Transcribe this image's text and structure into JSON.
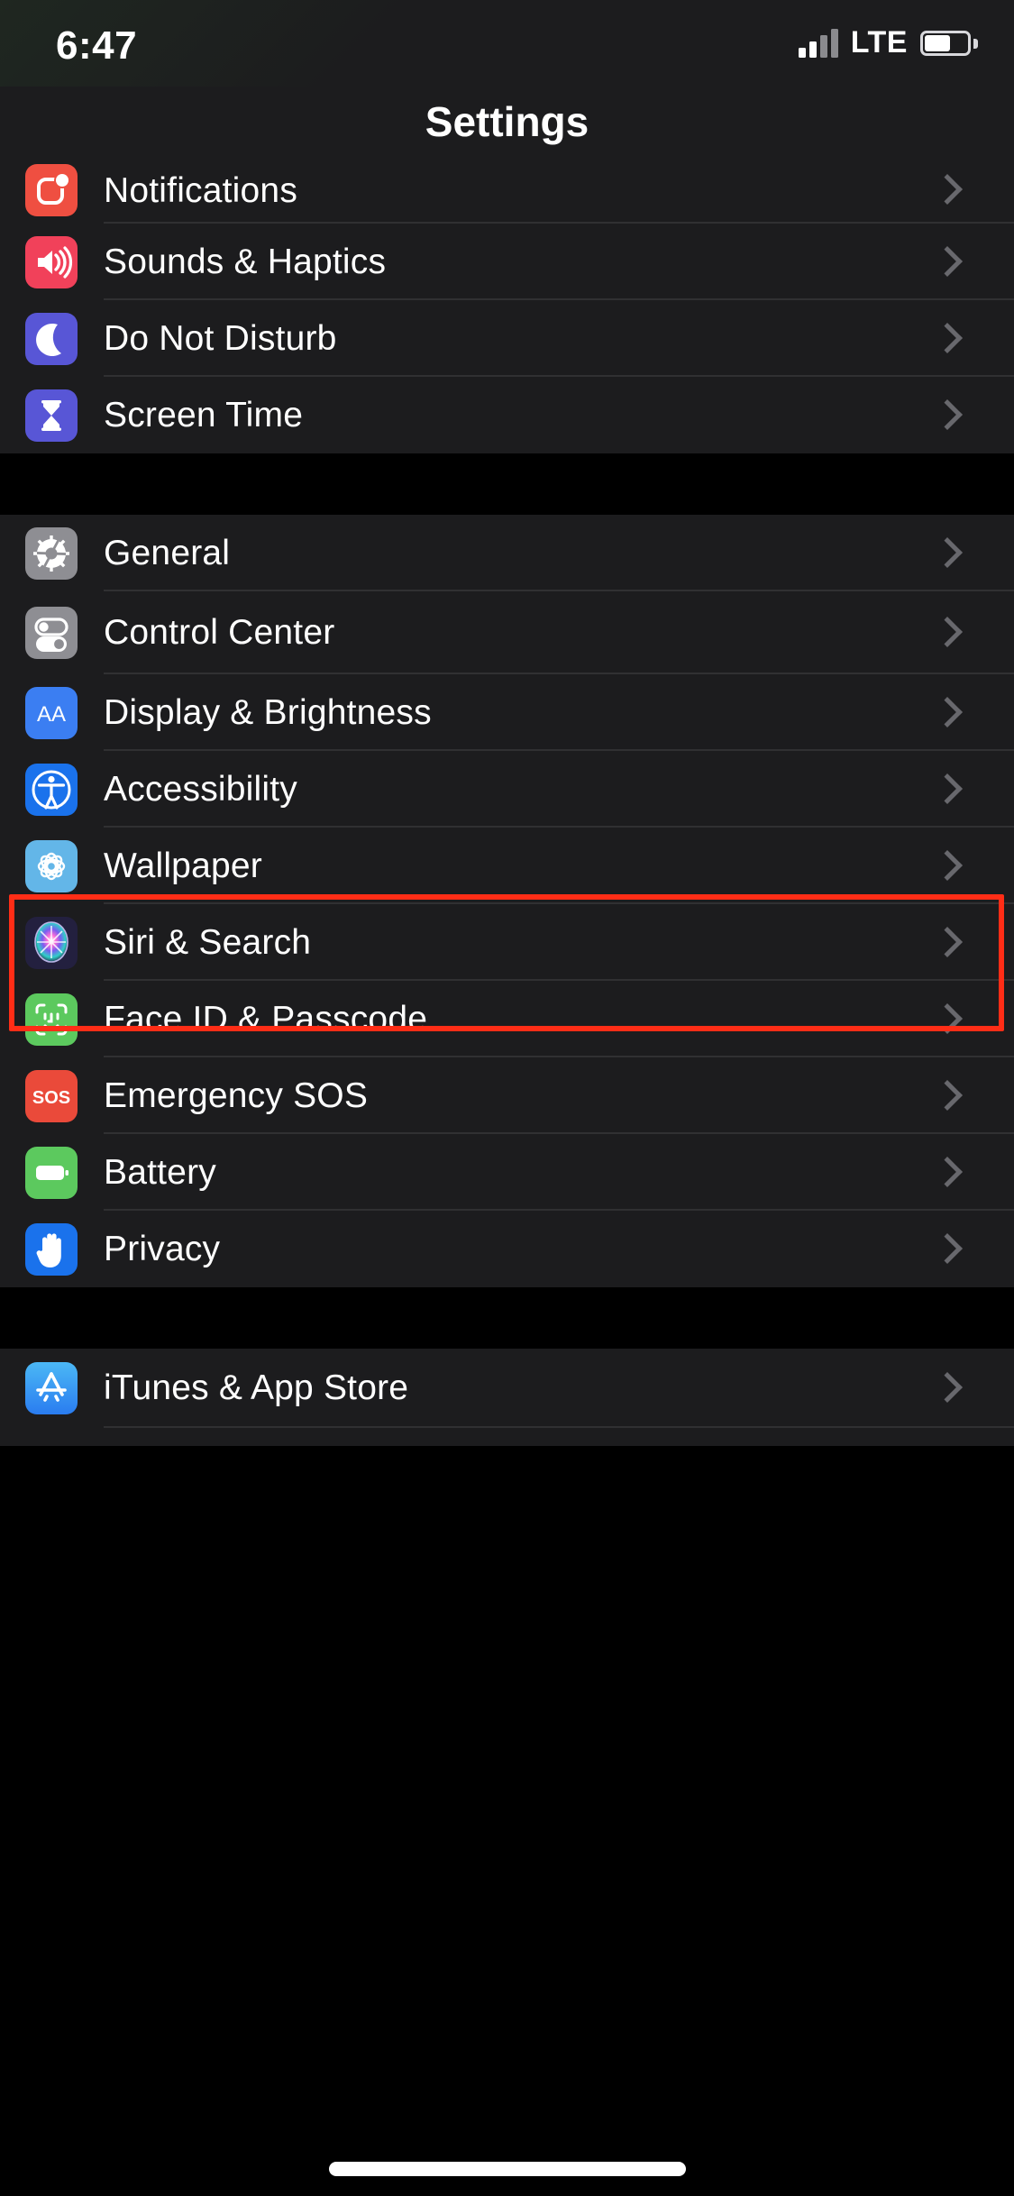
{
  "status_bar": {
    "time": "6:47",
    "carrier_tech": "LTE",
    "signal_bars_filled": 2,
    "signal_bars_total": 4,
    "battery_level_pct": 55
  },
  "nav": {
    "title": "Settings"
  },
  "colors": {
    "group_bg": "#1c1c1e",
    "page_bg": "#000000",
    "separator": "#303032",
    "chevron": "#68686d",
    "label_text": "#ffffff",
    "highlight_box": "#ff2d16"
  },
  "highlight": {
    "target_row": "Control Center",
    "color": "#ff2d16"
  },
  "groups": [
    {
      "id": "group-notifications",
      "partial_first_row": true,
      "rows": [
        {
          "label": "Notifications",
          "icon": "notifications-icon",
          "icon_color": "#ef4f41",
          "chevron": true
        },
        {
          "label": "Sounds & Haptics",
          "icon": "speaker-icon",
          "icon_color": "#f1415a",
          "chevron": true
        },
        {
          "label": "Do Not Disturb",
          "icon": "moon-icon",
          "icon_color": "#5856d6",
          "chevron": true
        },
        {
          "label": "Screen Time",
          "icon": "hourglass-icon",
          "icon_color": "#5856d6",
          "chevron": true
        }
      ]
    },
    {
      "id": "group-general",
      "partial_first_row": false,
      "rows": [
        {
          "label": "General",
          "icon": "gear-icon",
          "icon_color": "#8e8e93",
          "chevron": true
        },
        {
          "label": "Control Center",
          "icon": "toggles-icon",
          "icon_color": "#8e8e93",
          "chevron": true,
          "highlighted": true
        },
        {
          "label": "Display & Brightness",
          "icon": "text-size-aa-icon",
          "icon_color": "#3b7ef2",
          "chevron": true
        },
        {
          "label": "Accessibility",
          "icon": "accessibility-icon",
          "icon_color": "#1a72ec",
          "chevron": true
        },
        {
          "label": "Wallpaper",
          "icon": "flower-icon",
          "icon_color": "#63b6e8",
          "chevron": true
        },
        {
          "label": "Siri & Search",
          "icon": "siri-icon",
          "icon_color": "#2a2a4e",
          "chevron": true
        },
        {
          "label": "Face ID & Passcode",
          "icon": "face-id-icon",
          "icon_color": "#5bd濃",
          "chevron": true
        },
        {
          "label": "Emergency SOS",
          "icon": "sos-icon",
          "icon_color": "#ea4a3a",
          "chevron": true
        },
        {
          "label": "Battery",
          "icon": "battery-icon",
          "icon_color": "#5cc95e",
          "chevron": true
        },
        {
          "label": "Privacy",
          "icon": "hand-icon",
          "icon_color": "#1a72ec",
          "chevron": true
        }
      ]
    },
    {
      "id": "group-store",
      "partial_first_row": false,
      "rows": [
        {
          "label": "iTunes & App Store",
          "icon": "app-store-icon",
          "icon_color": "#3ba3f2",
          "chevron": true
        }
      ]
    }
  ],
  "home_indicator": {
    "visible": true
  }
}
